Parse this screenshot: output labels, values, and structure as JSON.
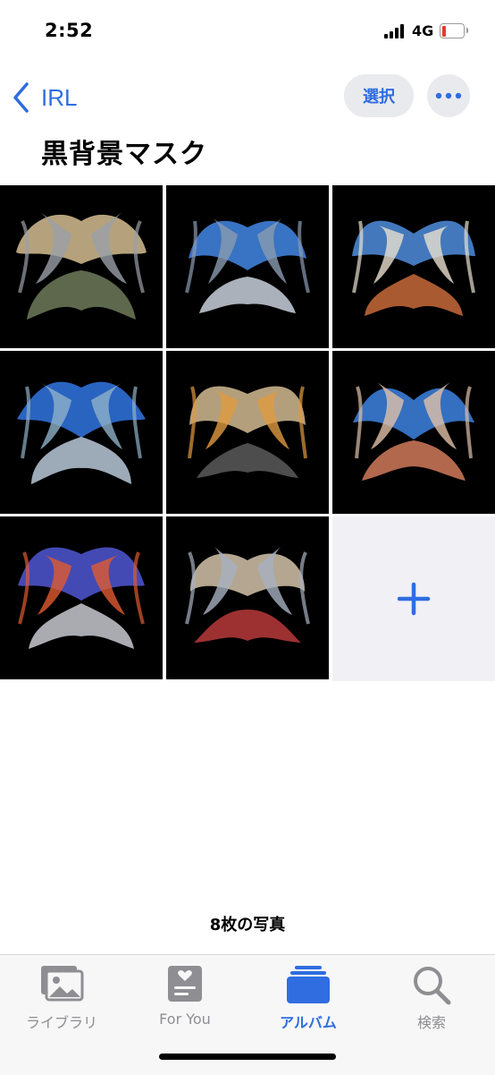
{
  "status": {
    "time": "2:52",
    "network": "4G"
  },
  "nav": {
    "back_label": "IRL",
    "select_label": "選択"
  },
  "album": {
    "title": "黒背景マスク",
    "count_label": "8枚の写真"
  },
  "photos": [
    {
      "palette": [
        "#c9b48a",
        "#6f7a5a",
        "#9aa0a8"
      ]
    },
    {
      "palette": [
        "#3f7fd8",
        "#c8d0dc",
        "#8a9bb0"
      ]
    },
    {
      "palette": [
        "#4a86d0",
        "#c86a3a",
        "#e8e0d0"
      ]
    },
    {
      "palette": [
        "#2f6fd6",
        "#b9c8d8",
        "#8fb0c8"
      ]
    },
    {
      "palette": [
        "#c8b08a",
        "#5a5a5a",
        "#e09a40"
      ]
    },
    {
      "palette": [
        "#3a7bd5",
        "#d07a5a",
        "#e0c0a8"
      ]
    },
    {
      "palette": [
        "#4b52c8",
        "#c8c8d0",
        "#e05a30"
      ]
    },
    {
      "palette": [
        "#c8b8a0",
        "#b83a3a",
        "#a8b0c0"
      ]
    }
  ],
  "tabs": [
    {
      "label": "ライブラリ",
      "icon": "photo-library-icon"
    },
    {
      "label": "For You",
      "icon": "for-you-icon"
    },
    {
      "label": "アルバム",
      "icon": "albums-icon",
      "active": true
    },
    {
      "label": "検索",
      "icon": "search-icon"
    }
  ],
  "colors": {
    "accent": "#2f6de0",
    "inactive": "#8e8e93",
    "battery_low": "#e33c32"
  }
}
